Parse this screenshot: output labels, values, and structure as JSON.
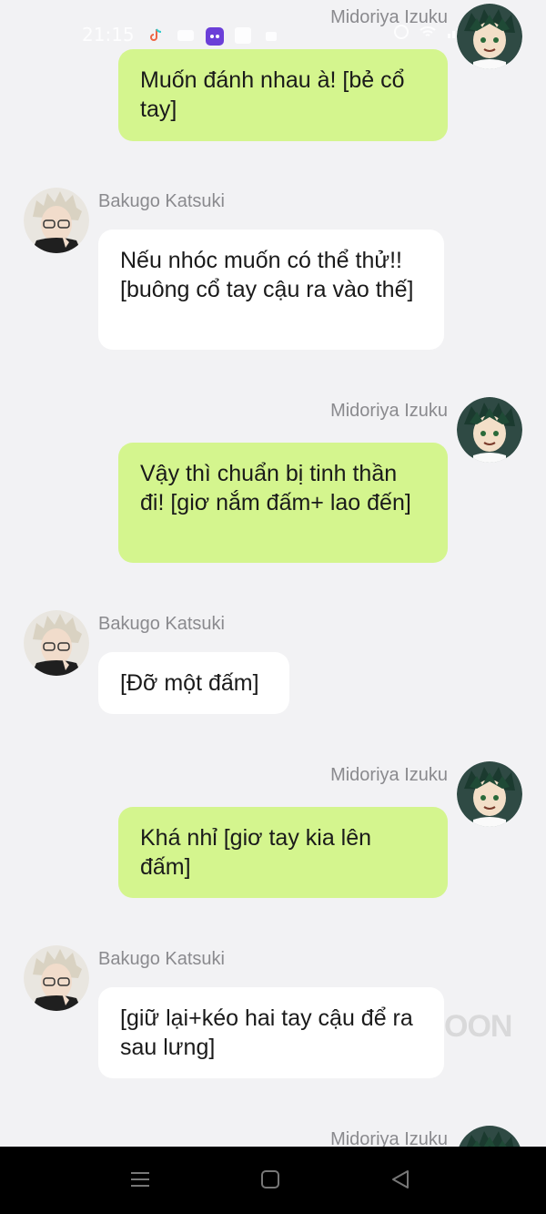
{
  "status_bar": {
    "time": "21:15"
  },
  "names": {
    "midoriya": "Midoriya Izuku",
    "bakugo": "Bakugo Katsuki"
  },
  "messages": [
    {
      "sender": "Midoriya Izuku",
      "text": "Muốn đánh nhau à! [bẻ cổ tay]"
    },
    {
      "sender": "Bakugo Katsuki",
      "text": "Nếu nhóc muốn có thể thử!! [buông cổ tay cậu ra vào thế]"
    },
    {
      "sender": "Midoriya Izuku",
      "text": "Vậy thì chuẩn bị tinh thần đi! [giơ nắm đấm+ lao đến]"
    },
    {
      "sender": "Bakugo Katsuki",
      "text": "[Đỡ một đấm]"
    },
    {
      "sender": "Midoriya Izuku",
      "text": "Khá nhỉ [giơ tay kia lên đấm]"
    },
    {
      "sender": "Bakugo Katsuki",
      "text": "[giữ lại+kéo hai tay cậu để ra sau lưng]"
    },
    {
      "sender": "Midoriya Izuku",
      "text": ""
    }
  ],
  "watermark": "OON",
  "colors": {
    "mine_bubble": "#d4f58e",
    "theirs_bubble": "#ffffff",
    "background": "#f2f2f4"
  }
}
